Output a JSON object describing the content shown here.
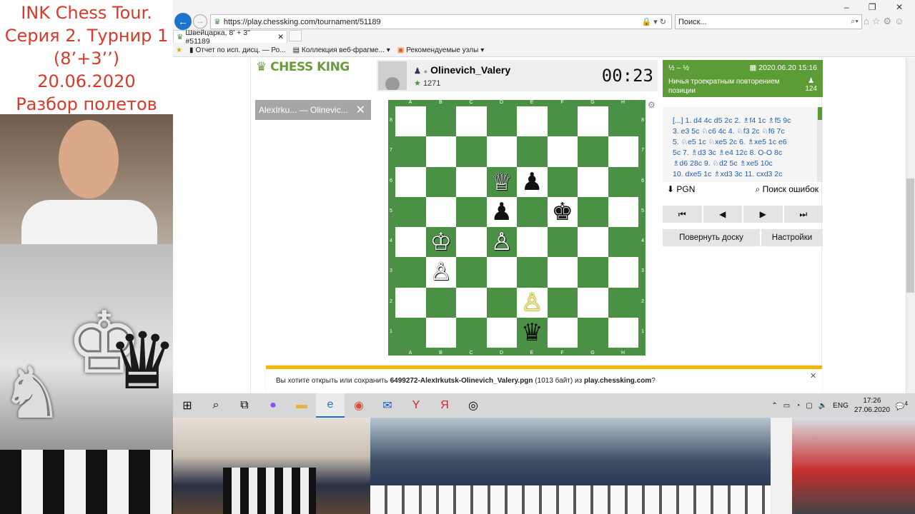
{
  "overlay": {
    "title_lines": [
      "INK Chess Tour.",
      "Серия 2. Турнир 1",
      "(8’+3’’)",
      "20.06.2020",
      "Разбор полетов"
    ]
  },
  "browser": {
    "url": "https://play.chessking.com/tournament/51189",
    "search_placeholder": "Поиск...",
    "tab_title": "Швейцарка, 8' + 3'' #51189",
    "favorites": [
      "Отчет по исп. дисц. — Ро...",
      "Коллекция веб-фрагме...",
      "Рекомендуемые узлы"
    ],
    "window_controls": [
      "–",
      "❐",
      "✕"
    ]
  },
  "site": {
    "logo_text": "CHESS KING",
    "game_tab": "AlexIrku... — Olinevic...",
    "player": {
      "name": "Olinevich_Valery",
      "rating": "1271"
    },
    "clock": "00:23",
    "result": {
      "score": "½ – ½",
      "date": "2020.06.20 15:16",
      "reason": "Ничья троекратным повторением позиции",
      "moves_count": "124"
    },
    "moves_lines": [
      "[...] 1. d4 4c d5 2c 2. ♗f4 1c ♗f5 9c",
      "3. e3 5c ♘c6 4c 4. ♘f3 2c ♘f6 7c",
      "5. ♘e5 1c ♘xe5 2c 6. ♗xe5 1c e6",
      "5c 7. ♗d3 3c ♗e4 12c 8. O-O 8c",
      "♗d6 28c 9. ♘d2 5c ♗xe5 10c",
      "10. dxe5 1c ♗xd3 3c 11. cxd3 2c"
    ],
    "pgn_label": "PGN",
    "error_search_label": "Поиск ошибок",
    "nav_buttons": [
      "⏮",
      "◀",
      "▶",
      "⏭"
    ],
    "flip_label": "Повернуть доску",
    "settings_label": "Настройки"
  },
  "board": {
    "files": [
      "A",
      "B",
      "C",
      "D",
      "E",
      "F",
      "G",
      "H"
    ],
    "ranks": [
      "8",
      "7",
      "6",
      "5",
      "4",
      "3",
      "2",
      "1"
    ],
    "pieces": [
      {
        "square": "d6",
        "glyph": "♕",
        "color": "white"
      },
      {
        "square": "e6",
        "glyph": "♟",
        "color": "black"
      },
      {
        "square": "d5",
        "glyph": "♟",
        "color": "black"
      },
      {
        "square": "f5",
        "glyph": "♚",
        "color": "black"
      },
      {
        "square": "b4",
        "glyph": "♔",
        "color": "white"
      },
      {
        "square": "d4",
        "glyph": "♙",
        "color": "white"
      },
      {
        "square": "b3",
        "glyph": "♙",
        "color": "white"
      },
      {
        "square": "e2",
        "glyph": "♙",
        "color": "highlight"
      },
      {
        "square": "e1",
        "glyph": "♛",
        "color": "black"
      }
    ]
  },
  "download_bar": {
    "prefix": "Вы хотите открыть или сохранить ",
    "filename": "6499272-AlexIrkutsk-Olinevich_Valery.pgn",
    "suffix": " (1013 байт) из ",
    "host": "play.chessking.com",
    "end": "?"
  },
  "taskbar": {
    "language": "ENG",
    "time": "17:26",
    "date": "27.06.2020",
    "notification_count": "4"
  }
}
